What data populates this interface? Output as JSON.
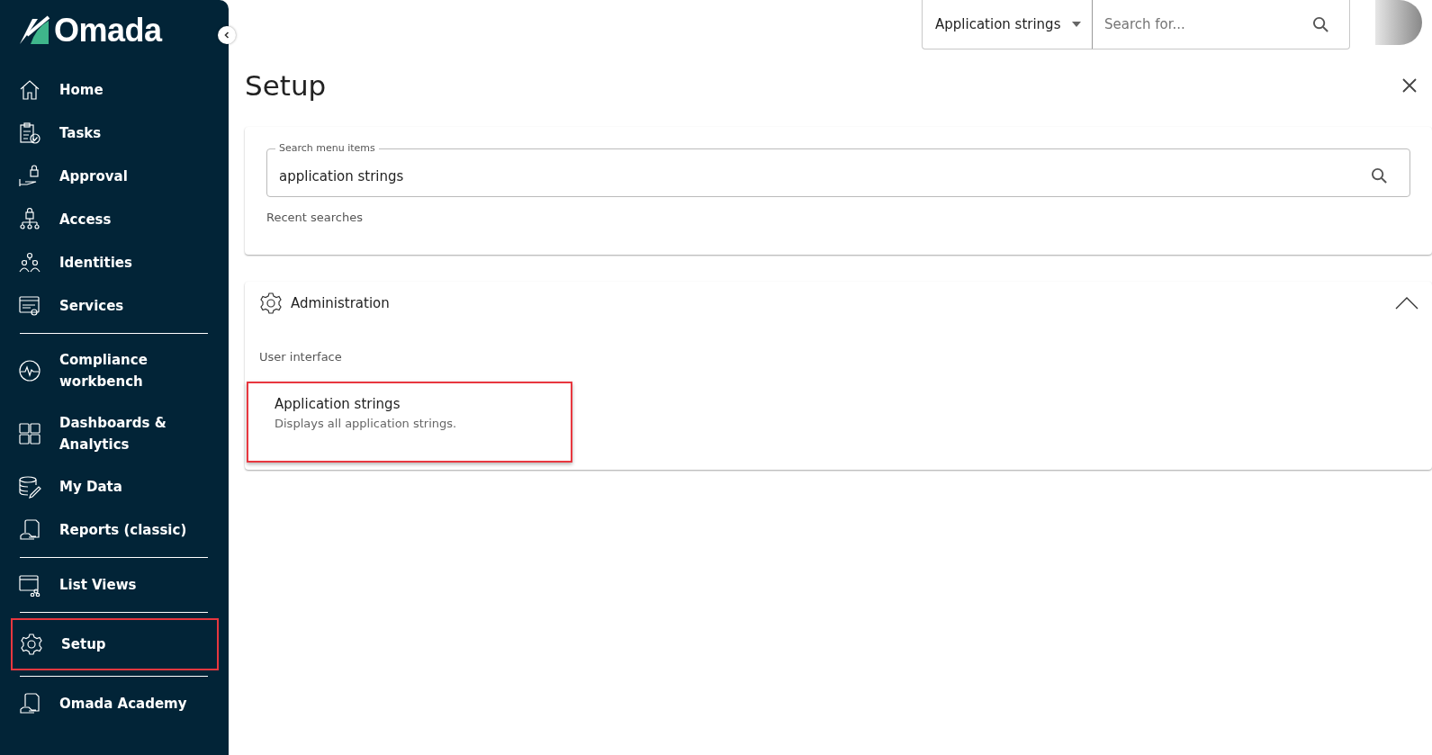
{
  "sidebar": {
    "logo": "Omada",
    "groups": [
      [
        {
          "label": "Home",
          "selected": false
        },
        {
          "label": "Tasks",
          "selected": false
        },
        {
          "label": "Approval",
          "selected": false
        },
        {
          "label": "Access",
          "selected": false
        },
        {
          "label": "Identities",
          "selected": false
        },
        {
          "label": "Services",
          "selected": false
        }
      ],
      [
        {
          "label": "Compliance workbench",
          "selected": false
        },
        {
          "label": "Dashboards & Analytics",
          "selected": false
        },
        {
          "label": "My Data",
          "selected": false
        },
        {
          "label": "Reports (classic)",
          "selected": false
        }
      ],
      [
        {
          "label": "List Views",
          "selected": false
        }
      ],
      [
        {
          "label": "Setup",
          "selected": true
        }
      ],
      [
        {
          "label": "Omada Academy",
          "selected": false
        }
      ]
    ]
  },
  "header": {
    "scope": "Application strings",
    "search": {
      "placeholder": "Search for..."
    }
  },
  "page": {
    "title": "Setup",
    "menu_search": {
      "label": "Search menu items",
      "value": "application strings",
      "recent_label": "Recent searches"
    },
    "section": {
      "title": "Administration",
      "expanded": true,
      "group": "User interface",
      "results": [
        {
          "title": "Application strings",
          "description": "Displays all application strings.",
          "highlighted": true
        }
      ]
    }
  }
}
